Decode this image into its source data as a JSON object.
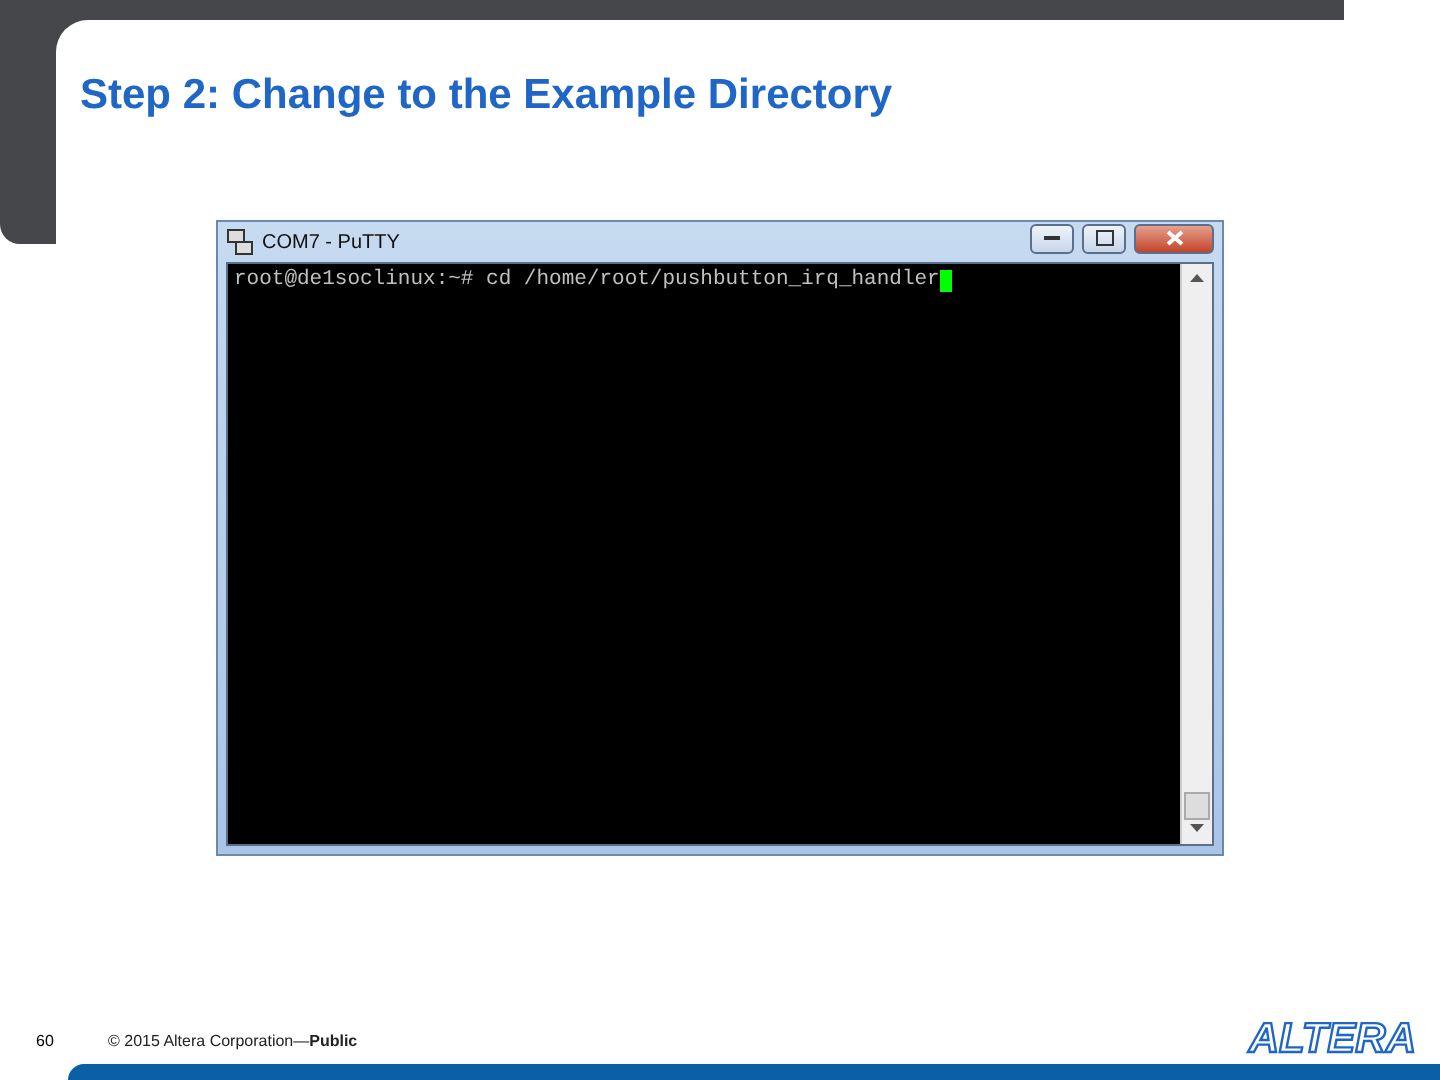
{
  "slide": {
    "title": "Step 2: Change to the Example Directory",
    "page_number": "60"
  },
  "window": {
    "title": "COM7 - PuTTY",
    "terminal": {
      "lines": [
        "root@de1soclinux:~# cd /home/root/pushbutton_irq_handler"
      ],
      "cursor": true
    }
  },
  "footer": {
    "copyright": "© 2015 Altera Corporation—**Public**",
    "logo": "ALTERA"
  }
}
